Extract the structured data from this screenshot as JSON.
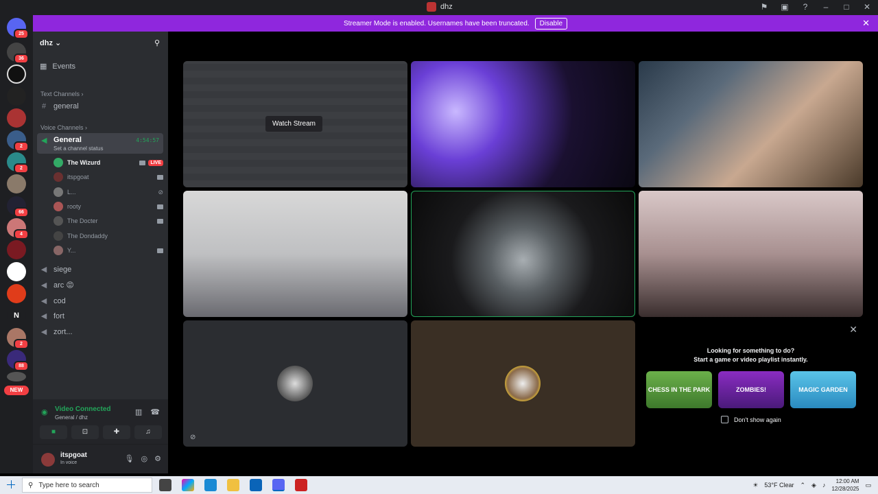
{
  "window": {
    "title": "dhz"
  },
  "banner": {
    "text": "Streamer Mode is enabled. Usernames have been truncated.",
    "button": "Disable",
    "close": "✕"
  },
  "guilds": {
    "badges": [
      "25",
      "36",
      "2",
      "2",
      "66",
      "4",
      "2",
      "88"
    ],
    "new_label": "NEW",
    "letter_icon": "N"
  },
  "server": {
    "name": "dhz",
    "chevron": "⌄"
  },
  "sidebar": {
    "events_label": "Events",
    "text_category": "Text Channels",
    "text_channels": [
      "general"
    ],
    "voice_category": "Voice Channels",
    "general_voice": {
      "name": "General",
      "status": "Set a channel status",
      "timer": "4:54:57"
    },
    "voice_users": [
      {
        "name": "The Wizurd",
        "live": "LIVE"
      },
      {
        "name": "itspgoat"
      },
      {
        "name": "L..."
      },
      {
        "name": "rooty"
      },
      {
        "name": "The Docter"
      },
      {
        "name": "The Dondaddy"
      },
      {
        "name": "Y..."
      }
    ],
    "other_voice": [
      "siege",
      "arc 😡",
      "cod",
      "fort",
      "zort..."
    ]
  },
  "voice_connected": {
    "title": "Video Connected",
    "subtitle": "General / dhz"
  },
  "user": {
    "name": "itspgoat",
    "status": "In voice"
  },
  "stage": {
    "watch_stream": "Watch Stream",
    "activity": {
      "title": "Looking for something to do?",
      "subtitle": "Start a game or video playlist instantly.",
      "games": [
        "CHESS IN THE PARK",
        "ZOMBIES!",
        "MAGIC GARDEN"
      ],
      "dont_show": "Don't show again"
    }
  },
  "taskbar": {
    "search_placeholder": "Type here to search",
    "weather": "53°F Clear",
    "time": "12:00 AM",
    "date": "12/28/2025"
  }
}
